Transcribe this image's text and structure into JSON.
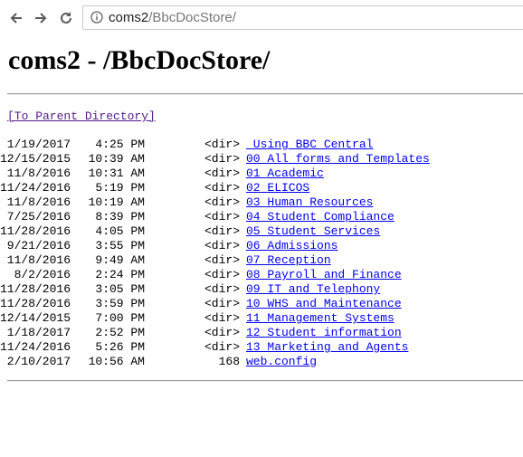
{
  "browser": {
    "url_host": "coms2",
    "url_path": "/BbcDocStore/"
  },
  "page": {
    "title": "coms2 - /BbcDocStore/",
    "parent_link": "[To Parent Directory]"
  },
  "listing": [
    {
      "date": "1/19/2017",
      "time": "4:25 PM",
      "kind": "<dir>",
      "name": "_Using_BBC_Central"
    },
    {
      "date": "12/15/2015",
      "time": "10:39 AM",
      "kind": "<dir>",
      "name": "00_All forms and Templates"
    },
    {
      "date": "11/8/2016",
      "time": "10:31 AM",
      "kind": "<dir>",
      "name": "01_Academic"
    },
    {
      "date": "11/24/2016",
      "time": "5:19 PM",
      "kind": "<dir>",
      "name": "02_ELICOS"
    },
    {
      "date": "11/8/2016",
      "time": "10:19 AM",
      "kind": "<dir>",
      "name": "03_Human Resources"
    },
    {
      "date": "7/25/2016",
      "time": "8:39 PM",
      "kind": "<dir>",
      "name": "04_Student Compliance"
    },
    {
      "date": "11/28/2016",
      "time": "4:05 PM",
      "kind": "<dir>",
      "name": "05_Student Services"
    },
    {
      "date": "9/21/2016",
      "time": "3:55 PM",
      "kind": "<dir>",
      "name": "06_Admissions"
    },
    {
      "date": "11/8/2016",
      "time": "9:49 AM",
      "kind": "<dir>",
      "name": "07_Reception"
    },
    {
      "date": "8/2/2016",
      "time": "2:24 PM",
      "kind": "<dir>",
      "name": "08_Payroll and Finance"
    },
    {
      "date": "11/28/2016",
      "time": "3:05 PM",
      "kind": "<dir>",
      "name": "09_IT and Telephony"
    },
    {
      "date": "11/28/2016",
      "time": "3:59 PM",
      "kind": "<dir>",
      "name": "10_WHS and Maintenance"
    },
    {
      "date": "12/14/2015",
      "time": "7:00 PM",
      "kind": "<dir>",
      "name": "11_Management Systems"
    },
    {
      "date": "1/18/2017",
      "time": "2:52 PM",
      "kind": "<dir>",
      "name": "12_Student information"
    },
    {
      "date": "11/24/2016",
      "time": "5:26 PM",
      "kind": "<dir>",
      "name": "13_Marketing and Agents"
    },
    {
      "date": "2/10/2017",
      "time": "10:56 AM",
      "kind": "168",
      "name": "web.config"
    }
  ]
}
